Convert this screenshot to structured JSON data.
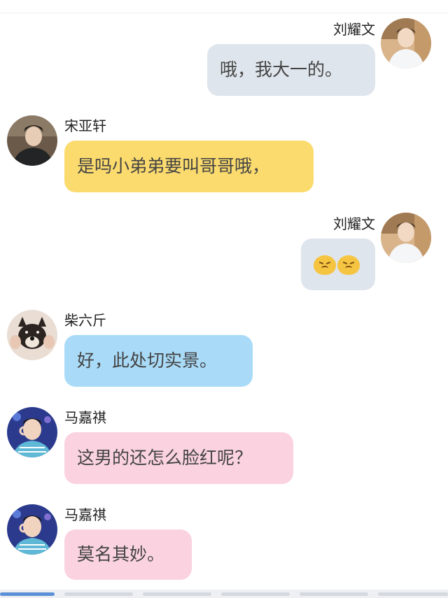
{
  "messages": [
    {
      "side": "right",
      "sender": "刘耀文",
      "text": "哦，我大一的。",
      "bubble_color": "#dfe5ec"
    },
    {
      "side": "left",
      "sender": "宋亚轩",
      "text": "是吗小弟弟要叫哥哥哦，",
      "bubble_color": "#fbdb6e"
    },
    {
      "side": "right",
      "sender": "刘耀文",
      "emoji": [
        "pouting-face-icon",
        "pouting-face-icon"
      ],
      "bubble_color": "#dfe5ec"
    },
    {
      "side": "left",
      "sender": "柴六斤",
      "text": "好，此处切实景。",
      "bubble_color": "#a9dbf8"
    },
    {
      "side": "left",
      "sender": "马嘉祺",
      "text": "这男的还怎么脸红呢？",
      "bubble_color": "#fbd3e0"
    },
    {
      "side": "left",
      "sender": "马嘉祺",
      "text": "莫名其妙。",
      "bubble_color": "#fbd3e0"
    }
  ]
}
